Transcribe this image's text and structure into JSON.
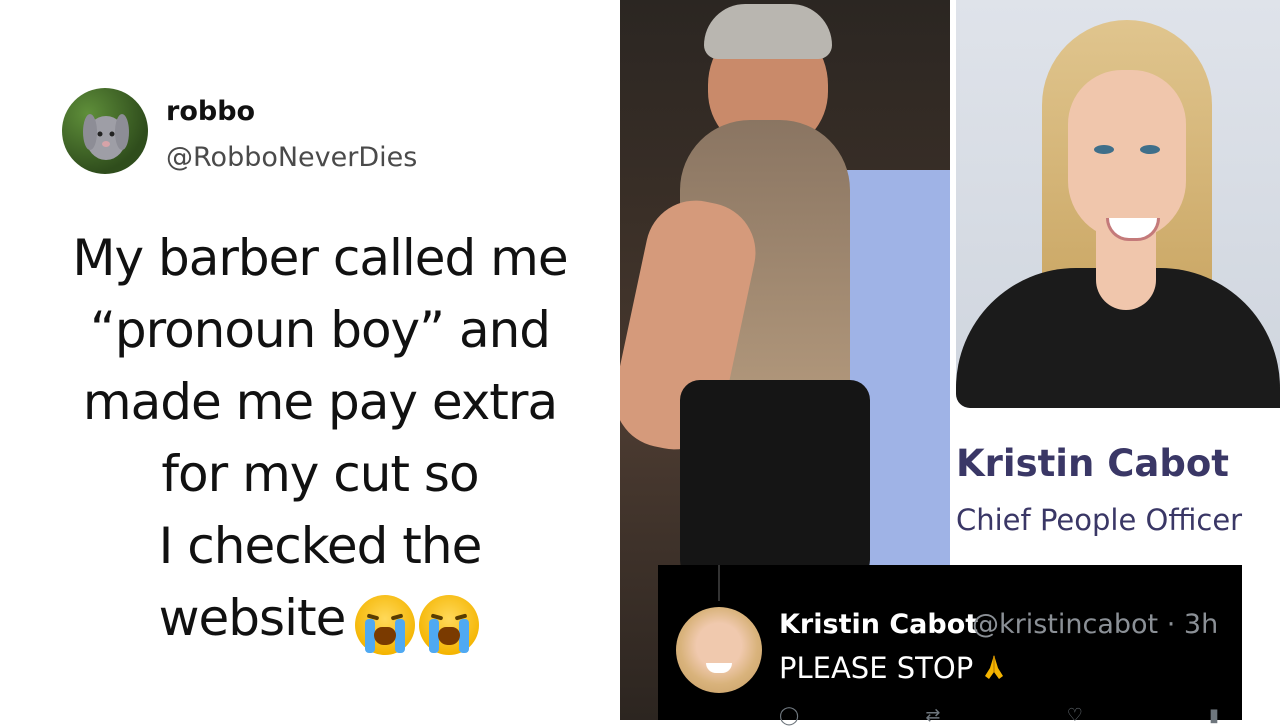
{
  "tweet": {
    "display_name": "robbo",
    "handle": "@RobboNeverDies",
    "lines": [
      "My barber called me",
      "“pronoun boy” and",
      "made me pay extra",
      "for my cut so",
      "I checked the",
      "website"
    ],
    "emoji": [
      "loudly-crying-face",
      "loudly-crying-face"
    ]
  },
  "profile_card": {
    "name": "Kristin Cabot",
    "title": "Chief People Officer"
  },
  "reply": {
    "name": "Kristin Cabot",
    "meta": "@kristincabot · 3h",
    "text": "PLEASE STOP",
    "emoji": "folded-hands"
  },
  "colors": {
    "card_text": "#3a3766",
    "reply_bg": "#000000",
    "meta_gray": "#8b9096"
  }
}
